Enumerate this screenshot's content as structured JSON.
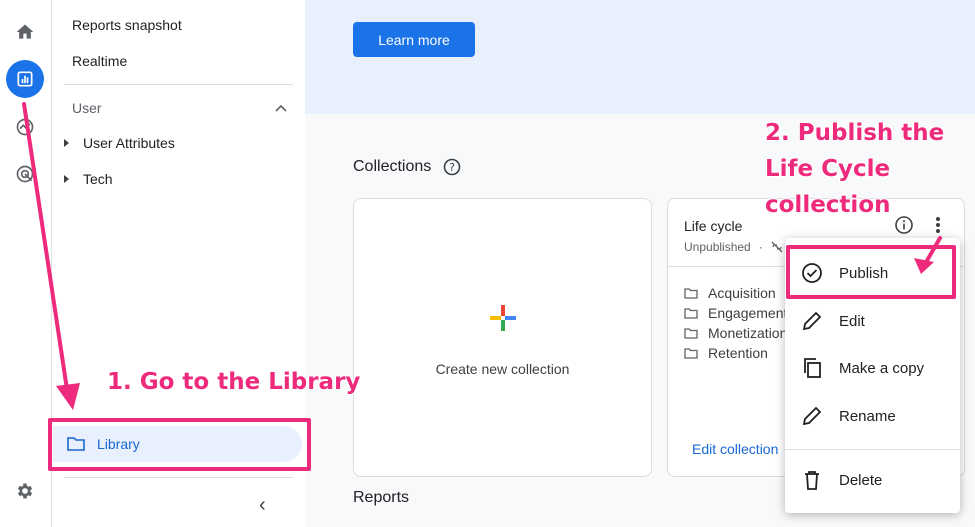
{
  "rail": {
    "items": [
      {
        "icon": "home-icon",
        "active": false
      },
      {
        "icon": "reports-icon",
        "active": true
      },
      {
        "icon": "explore-icon",
        "active": false
      },
      {
        "icon": "advertising-icon",
        "active": false
      }
    ],
    "settings_icon": "gear-icon"
  },
  "nav": {
    "reports_snapshot": "Reports snapshot",
    "realtime": "Realtime",
    "user_section": "User",
    "user_attributes": "User Attributes",
    "tech": "Tech",
    "library": "Library"
  },
  "banner": {
    "learn_more": "Learn more"
  },
  "collections": {
    "title": "Collections",
    "create_new": "Create new collection",
    "life_cycle": {
      "title": "Life cycle",
      "status": "Unpublished",
      "topics": [
        "Acquisition",
        "Engagement",
        "Monetization",
        "Retention"
      ],
      "edit_link": "Edit collection"
    }
  },
  "reports": {
    "title": "Reports"
  },
  "menu": {
    "publish": "Publish",
    "edit": "Edit",
    "make_copy": "Make a copy",
    "rename": "Rename",
    "delete": "Delete"
  },
  "annotations": {
    "step1": "1. Go to the Library",
    "step2_line1": "2. Publish the",
    "step2_line2": "Life Cycle",
    "step2_line3": "collection"
  },
  "colors": {
    "accent": "#1a73e8",
    "annotation": "#ed2a7b",
    "banner": "#e8f0fe"
  }
}
